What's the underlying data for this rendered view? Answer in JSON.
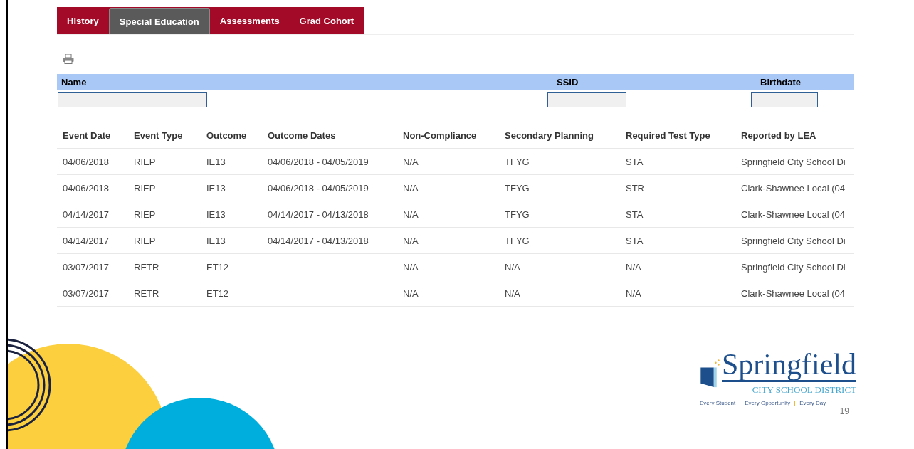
{
  "tabs": [
    {
      "label": "History",
      "selected": false
    },
    {
      "label": "Special Education",
      "selected": true
    },
    {
      "label": "Assessments",
      "selected": false
    },
    {
      "label": "Grad Cohort",
      "selected": false
    }
  ],
  "filters": [
    {
      "label": "Name"
    },
    {
      "label": "SSID"
    },
    {
      "label": "Birthdate"
    }
  ],
  "table": {
    "columns": [
      "Event Date",
      "Event Type",
      "Outcome",
      "Outcome Dates",
      "Non-Compliance",
      "Secondary Planning",
      "Required Test Type",
      "Reported by LEA"
    ],
    "rows": [
      [
        "04/06/2018",
        "RIEP",
        "IE13",
        "04/06/2018 - 04/05/2019",
        "N/A",
        "TFYG",
        "STA",
        "Springfield City School Di"
      ],
      [
        "04/06/2018",
        "RIEP",
        "IE13",
        "04/06/2018 - 04/05/2019",
        "N/A",
        "TFYG",
        "STR",
        "Clark-Shawnee Local (04"
      ],
      [
        "04/14/2017",
        "RIEP",
        "IE13",
        "04/14/2017 - 04/13/2018",
        "N/A",
        "TFYG",
        "STA",
        "Clark-Shawnee Local (04"
      ],
      [
        "04/14/2017",
        "RIEP",
        "IE13",
        "04/14/2017 - 04/13/2018",
        "N/A",
        "TFYG",
        "STA",
        "Springfield City School Di"
      ],
      [
        "03/07/2017",
        "RETR",
        "ET12",
        "",
        "N/A",
        "N/A",
        "N/A",
        "Springfield City School Di"
      ],
      [
        "03/07/2017",
        "RETR",
        "ET12",
        "",
        "N/A",
        "N/A",
        "N/A",
        "Clark-Shawnee Local (04"
      ]
    ]
  },
  "logo": {
    "name": "Springfield",
    "subtitle": "CITY SCHOOL DISTRICT",
    "tagline": [
      "Every Student",
      "Every Opportunity",
      "Every Day"
    ]
  },
  "page_number": "19"
}
